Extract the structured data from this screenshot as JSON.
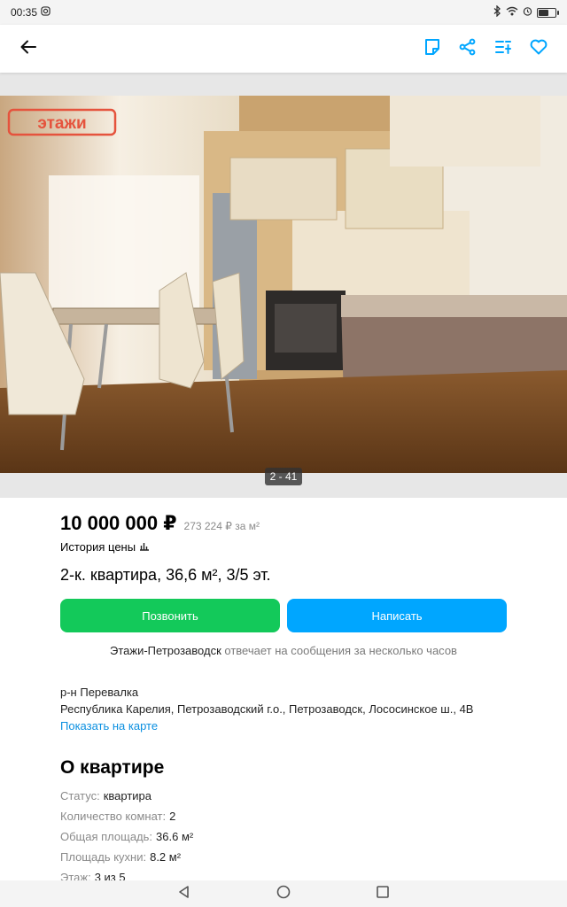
{
  "status": {
    "time": "00:35",
    "battery_level": 0.55
  },
  "icons": {
    "back": "arrow-left-icon",
    "note": "note-icon",
    "share": "share-icon",
    "compare": "compare-icon",
    "favorite": "heart-icon"
  },
  "colors": {
    "accent": "#00a6ff",
    "call": "#13c95a",
    "link": "#0a8fe0",
    "watermark": "#e5533d"
  },
  "gallery": {
    "watermark": "этажи",
    "counter": "2 - 41"
  },
  "listing": {
    "price": "10 000 000 ₽",
    "price_per_m2": "273 224 ₽ за м²",
    "history_label": "История цены",
    "title": "2-к. квартира, 36,6 м², 3/5 эт.",
    "call_label": "Позвонить",
    "write_label": "Написать",
    "seller_name": "Этажи-Петрозаводск",
    "seller_note": " отвечает на сообщения за несколько часов",
    "district": "р-н Перевалка",
    "address": "Республика Карелия, Петрозаводский г.о., Петрозаводск, Лососинское ш., 4В",
    "map_link": "Показать на карте"
  },
  "about": {
    "title": "О квартире",
    "params": [
      {
        "k": "Статус:",
        "v": "квартира"
      },
      {
        "k": "Количество комнат:",
        "v": "2"
      },
      {
        "k": "Общая площадь:",
        "v": "36.6 м²"
      },
      {
        "k": "Площадь кухни:",
        "v": "8.2 м²"
      },
      {
        "k": "Этаж:",
        "v": "3 из 5"
      }
    ]
  }
}
